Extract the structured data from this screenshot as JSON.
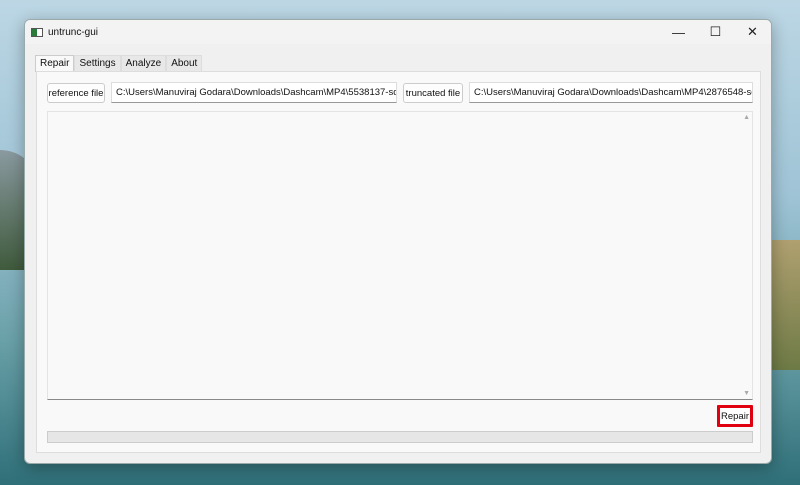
{
  "window": {
    "title": "untrunc-gui",
    "minimize": "—",
    "maximize": "☐",
    "close": "✕"
  },
  "tabs": [
    {
      "label": "Repair"
    },
    {
      "label": "Settings"
    },
    {
      "label": "Analyze"
    },
    {
      "label": "About"
    }
  ],
  "repair_tab": {
    "reference_button": "reference file",
    "reference_path": "C:\\Users\\Manuviraj Godara\\Downloads\\Dashcam\\MP4\\5538137-sd",
    "truncated_button": "truncated file",
    "truncated_path": "C:\\Users\\Manuviraj Godara\\Downloads\\Dashcam\\MP4\\2876548-sc",
    "log_text": "",
    "repair_button": "Repair",
    "progress": 0
  }
}
